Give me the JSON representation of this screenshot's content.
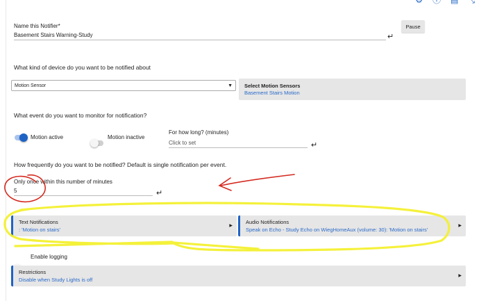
{
  "header": {
    "icons": [
      "gear-icon",
      "info-icon",
      "document-icon",
      "collapse-icon"
    ],
    "icon_color": "#1e63c4"
  },
  "name_field": {
    "label": "Name this Notifier*",
    "value": "Basement Stairs Warning-Study"
  },
  "pause_button": {
    "label": "Pause"
  },
  "device_question": "What kind of device do you want to be notified about",
  "device_select": {
    "value": "Motion Sensor"
  },
  "motion_sensors": {
    "title": "Select Motion Sensors",
    "value": "Basement Stairs Motion"
  },
  "event_question": "What event do you want to monitor for notification?",
  "motion_active": {
    "label": "Motion active",
    "on": true
  },
  "motion_inactive": {
    "label": "Motion inactive",
    "on": false
  },
  "how_long": {
    "label": "For how long? (minutes)",
    "placeholder": "Click to set"
  },
  "frequency_question": "How frequently do you want to be notified?  Default is single notification per event.",
  "once_within": {
    "label": "Only once within this number of minutes",
    "value": "5"
  },
  "text_notifications": {
    "title": "Text Notifications",
    "value": ": 'Motion on stairs'"
  },
  "audio_notifications": {
    "title": "Audio Notifications",
    "value": "Speak on  Echo - Study Echo on WiegHomeAux (volume: 30): 'Motion on stairs'"
  },
  "enable_logging": {
    "label": "Enable logging",
    "on": false
  },
  "restrictions": {
    "title": "Restrictions",
    "value": "Disable when Study Lights is off"
  },
  "colors": {
    "accent_blue": "#1e63c4",
    "annotation_red": "#d42a1f",
    "annotation_yellow": "#f4f02a",
    "button_gray": "#e6e6e6"
  }
}
